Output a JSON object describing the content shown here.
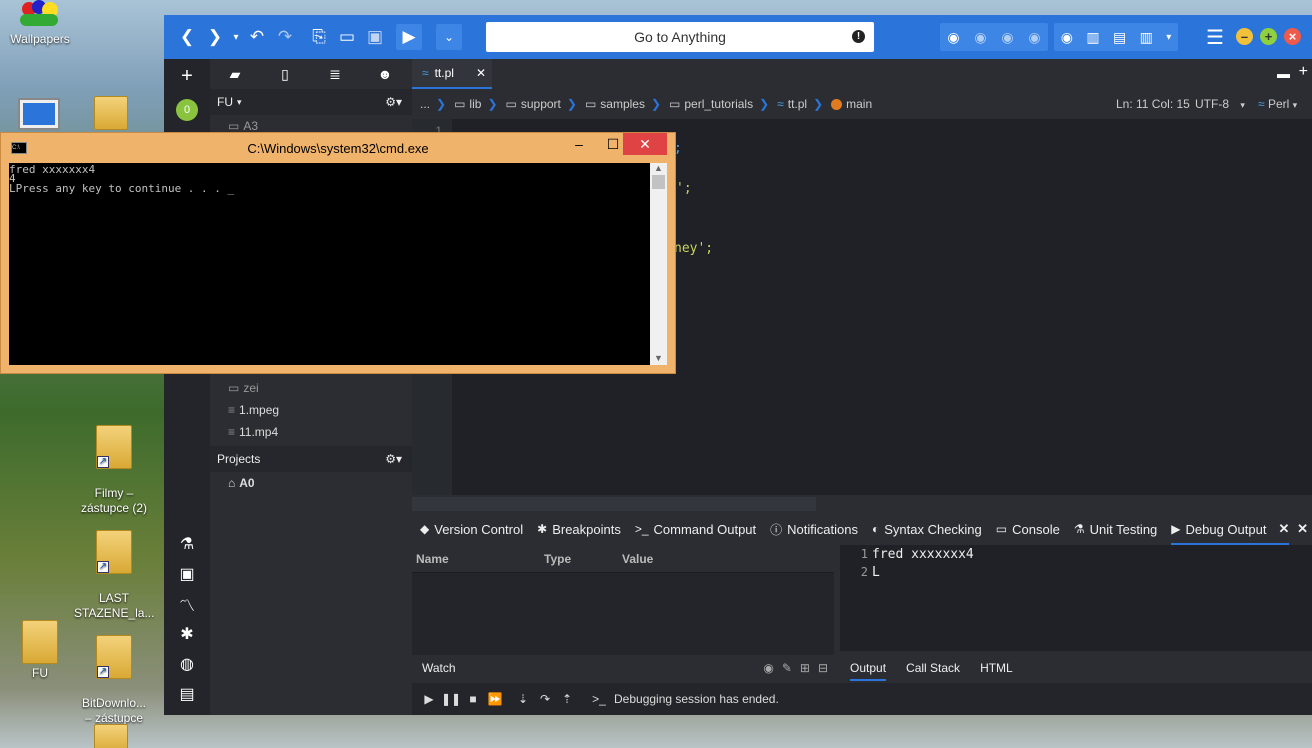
{
  "desktop": {
    "icons": [
      {
        "label": "Wallpapers"
      },
      {
        "label": "Filmy –\nzástupce (2)"
      },
      {
        "label": "LAST\nSTAZENE_la..."
      },
      {
        "label": "FU"
      },
      {
        "label": "BitDownlo...\n– zástupce"
      }
    ]
  },
  "komodo": {
    "goto_placeholder": "Go to Anything",
    "places": {
      "root_label": "FU",
      "hidden_row_1": "A3",
      "hidden_row_2": "zei",
      "files": [
        "1.mpeg",
        "11.mp4"
      ],
      "projects_label": "Projects",
      "project_item": "A0"
    },
    "editor_tab": "tt.pl",
    "breadcrumb": [
      "...",
      "lib",
      "support",
      "samples",
      "perl_tutorials",
      "tt.pl",
      "main"
    ],
    "status": {
      "position": "Ln: 11 Col: 15",
      "encoding": "UTF-8",
      "language": "Perl"
    },
    "code": {
      "line_number": "1",
      "fragment_a": ";",
      "fragment_b": "';",
      "fragment_c": "ney';"
    },
    "bottom_tabs": [
      "Version Control",
      "Breakpoints",
      "Command Output",
      "Notifications",
      "Syntax Checking",
      "Console",
      "Unit Testing",
      "Debug Output"
    ],
    "watch": {
      "columns": [
        "Name",
        "Type",
        "Value"
      ],
      "footer_label": "Watch"
    },
    "debug_output": {
      "lines": [
        {
          "n": "1",
          "text": "fred xxxxxxx4"
        },
        {
          "n": "2",
          "text": "L"
        }
      ]
    },
    "output_tabs": [
      "Output",
      "Call Stack",
      "HTML"
    ],
    "debug_status": "Debugging session has ended."
  },
  "cmd": {
    "title": "C:\\Windows\\system32\\cmd.exe",
    "lines": [
      "fred xxxxxxx4",
      "4",
      "LPress any key to continue . . . _"
    ]
  }
}
